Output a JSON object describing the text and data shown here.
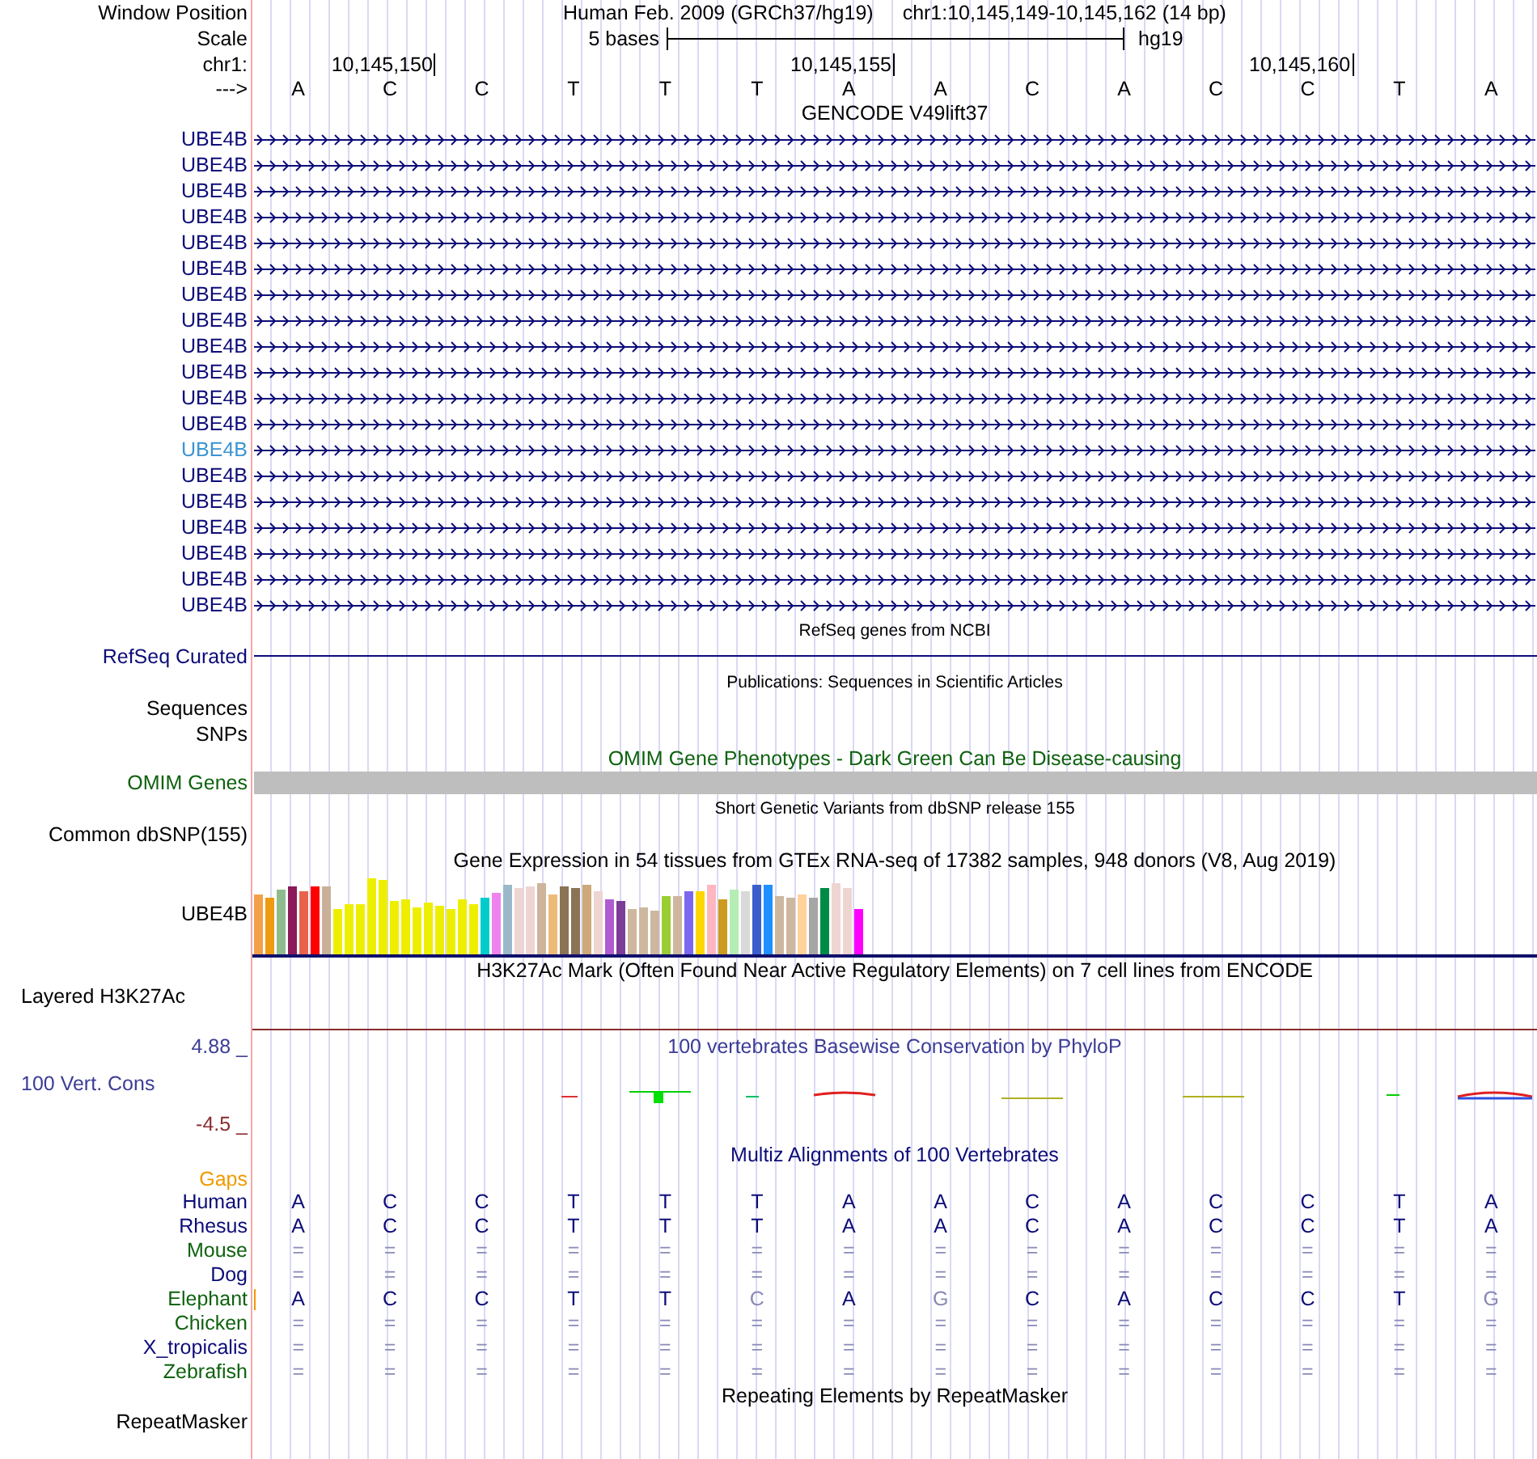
{
  "header": {
    "position_label": "Window Position",
    "assembly_title": "Human Feb. 2009 (GRCh37/hg19)",
    "position": "chr1:10,145,149-10,145,162 (14 bp)",
    "scale_label": "Scale",
    "scale_text": "5 bases",
    "assembly": "hg19",
    "chrom_label": "chr1:",
    "ruler_ticks": [
      "10,145,150",
      "10,145,155",
      "10,145,160"
    ],
    "strand_label": "--->",
    "bases": [
      "A",
      "C",
      "C",
      "T",
      "T",
      "T",
      "A",
      "A",
      "C",
      "A",
      "C",
      "C",
      "T",
      "A"
    ]
  },
  "tracks": [
    {
      "kind": "gene",
      "title": "GENCODE V49lift37",
      "color": "#0c0c78",
      "rows": [
        {
          "name": "UBE4B",
          "selected": false
        },
        {
          "name": "UBE4B",
          "selected": false
        },
        {
          "name": "UBE4B",
          "selected": false
        },
        {
          "name": "UBE4B",
          "selected": false
        },
        {
          "name": "UBE4B",
          "selected": false
        },
        {
          "name": "UBE4B",
          "selected": false
        },
        {
          "name": "UBE4B",
          "selected": false
        },
        {
          "name": "UBE4B",
          "selected": false
        },
        {
          "name": "UBE4B",
          "selected": false
        },
        {
          "name": "UBE4B",
          "selected": false
        },
        {
          "name": "UBE4B",
          "selected": false
        },
        {
          "name": "UBE4B",
          "selected": false
        },
        {
          "name": "UBE4B",
          "selected": true
        },
        {
          "name": "UBE4B",
          "selected": false
        },
        {
          "name": "UBE4B",
          "selected": false
        },
        {
          "name": "UBE4B",
          "selected": false
        },
        {
          "name": "UBE4B",
          "selected": false
        },
        {
          "name": "UBE4B",
          "selected": false
        },
        {
          "name": "UBE4B",
          "selected": false
        }
      ]
    },
    {
      "kind": "line",
      "caption": "RefSeq genes from NCBI",
      "label": "RefSeq Curated",
      "color": "#0c0c78"
    },
    {
      "kind": "pubs",
      "caption": "Publications: Sequences in Scientific Articles",
      "labels": [
        "Sequences",
        "SNPs"
      ],
      "color": "#000000"
    },
    {
      "kind": "bar",
      "caption": "OMIM Gene Phenotypes - Dark Green Can Be Disease-causing",
      "label": "OMIM Genes",
      "color": "#0e620e"
    },
    {
      "kind": "variants",
      "caption": "Short Genetic Variants from dbSNP release 155",
      "labels": [
        "Common dbSNP(155)"
      ],
      "color": "#000000"
    },
    {
      "kind": "expression",
      "caption": "Gene Expression in 54 tissues from GTEx RNA-seq of 17382 samples, 948 donors (V8, Aug 2019)",
      "label": "UBE4B",
      "color": "#000000"
    },
    {
      "kind": "signal",
      "caption": "H3K27Ac Mark (Often Found Near Active Regulatory Elements) on 7 cell lines from ENCODE",
      "label": "Layered H3K27Ac",
      "color": "#000000"
    },
    {
      "kind": "conservation",
      "caption": "100 vertebrates Basewise Conservation by PhyloP",
      "label": "100 Vert. Cons",
      "max_label": "4.88 _",
      "min_label": "-4.5 _",
      "color": "#3c3c96"
    },
    {
      "kind": "alignment",
      "caption": "Multiz Alignments of 100 Vertebrates",
      "gaps_label": "Gaps",
      "color": "#0c0c78",
      "species": [
        {
          "name": "Human",
          "color": "#0c0c78",
          "gap_marker": false,
          "bases": [
            "A",
            "C",
            "C",
            "T",
            "T",
            "T",
            "A",
            "A",
            "C",
            "A",
            "C",
            "C",
            "T",
            "A"
          ],
          "faded": [
            false,
            false,
            false,
            false,
            false,
            false,
            false,
            false,
            false,
            false,
            false,
            false,
            false,
            false
          ]
        },
        {
          "name": "Rhesus",
          "color": "#0c0c78",
          "gap_marker": false,
          "bases": [
            "A",
            "C",
            "C",
            "T",
            "T",
            "T",
            "A",
            "A",
            "C",
            "A",
            "C",
            "C",
            "T",
            "A"
          ],
          "faded": [
            false,
            false,
            false,
            false,
            false,
            false,
            false,
            false,
            false,
            false,
            false,
            false,
            false,
            false
          ]
        },
        {
          "name": "Mouse",
          "color": "#0e620e",
          "gap_marker": false,
          "bases": [
            "=",
            "=",
            "=",
            "=",
            "=",
            "=",
            "=",
            "=",
            "=",
            "=",
            "=",
            "=",
            "=",
            "="
          ],
          "faded": [
            true,
            true,
            true,
            true,
            true,
            true,
            true,
            true,
            true,
            true,
            true,
            true,
            true,
            true
          ]
        },
        {
          "name": "Dog",
          "color": "#0c0c78",
          "gap_marker": false,
          "bases": [
            "=",
            "=",
            "=",
            "=",
            "=",
            "=",
            "=",
            "=",
            "=",
            "=",
            "=",
            "=",
            "=",
            "="
          ],
          "faded": [
            true,
            true,
            true,
            true,
            true,
            true,
            true,
            true,
            true,
            true,
            true,
            true,
            true,
            true
          ]
        },
        {
          "name": "Elephant",
          "color": "#0e620e",
          "gap_marker": true,
          "bases": [
            "A",
            "C",
            "C",
            "T",
            "T",
            "C",
            "A",
            "G",
            "C",
            "A",
            "C",
            "C",
            "T",
            "G"
          ],
          "faded": [
            false,
            false,
            false,
            false,
            false,
            true,
            false,
            true,
            false,
            false,
            false,
            false,
            false,
            true
          ]
        },
        {
          "name": "Chicken",
          "color": "#0e620e",
          "gap_marker": false,
          "bases": [
            "=",
            "=",
            "=",
            "=",
            "=",
            "=",
            "=",
            "=",
            "=",
            "=",
            "=",
            "=",
            "=",
            "="
          ],
          "faded": [
            true,
            true,
            true,
            true,
            true,
            true,
            true,
            true,
            true,
            true,
            true,
            true,
            true,
            true
          ]
        },
        {
          "name": "X_tropicalis",
          "color": "#0c0c78",
          "gap_marker": false,
          "bases": [
            "=",
            "=",
            "=",
            "=",
            "=",
            "=",
            "=",
            "=",
            "=",
            "=",
            "=",
            "=",
            "=",
            "="
          ],
          "faded": [
            true,
            true,
            true,
            true,
            true,
            true,
            true,
            true,
            true,
            true,
            true,
            true,
            true,
            true
          ]
        },
        {
          "name": "Zebrafish",
          "color": "#0e620e",
          "gap_marker": false,
          "bases": [
            "=",
            "=",
            "=",
            "=",
            "=",
            "=",
            "=",
            "=",
            "=",
            "=",
            "=",
            "=",
            "=",
            "="
          ],
          "faded": [
            true,
            true,
            true,
            true,
            true,
            true,
            true,
            true,
            true,
            true,
            true,
            true,
            true,
            true
          ]
        }
      ]
    },
    {
      "kind": "repeats",
      "caption": "Repeating Elements by RepeatMasker",
      "labels": [
        "RepeatMasker"
      ],
      "color": "#000000"
    }
  ]
}
